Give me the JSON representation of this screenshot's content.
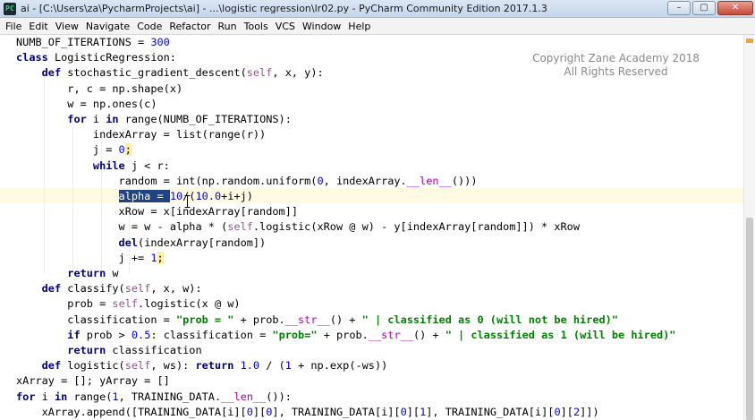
{
  "window": {
    "app_icon_text": "PC",
    "title": "ai - [C:\\Users\\za\\PycharmProjects\\ai] - ...\\logistic regression\\lr02.py - PyCharm Community Edition 2017.1.3",
    "controls": {
      "minimize": "–",
      "maximize": "▢",
      "close": "✕"
    }
  },
  "menu": [
    "File",
    "Edit",
    "View",
    "Navigate",
    "Code",
    "Refactor",
    "Run",
    "Tools",
    "VCS",
    "Window",
    "Help"
  ],
  "watermark": {
    "line1": "Copyright Zane Academy 2018",
    "line2": "All Rights Reserved"
  },
  "code": {
    "l1_a": "NUMB_OF_ITERATIONS = ",
    "l1_b": "300",
    "l2_kw": "class ",
    "l2_rest": "LogisticRegression:",
    "l3_kw": "def ",
    "l3_a": "stochastic_gradient_descent(",
    "l3_self": "self",
    "l3_b": ", x, y):",
    "l4": "r, c = np.shape(x)",
    "l5": "w = np.ones(c)",
    "l6_kw1": "for ",
    "l6_a": "i ",
    "l6_kw2": "in ",
    "l6_b": "range(NUMB_OF_ITERATIONS):",
    "l7": "indexArray = list(range(r))",
    "l8_a": "j = ",
    "l8_num": "0",
    "l8_b": ";",
    "l9_kw": "while ",
    "l9_b": "j < r:",
    "l10_a": "random = int(np.random.uniform(",
    "l10_n": "0",
    "l10_b": ", indexArray.",
    "l10_d": "__len__",
    "l10_c": "()))",
    "l11_sel": "alpha = ",
    "l11_n1": "10",
    "l11_a": "/(",
    "l11_n2": "10.0",
    "l11_b": "+i+j)",
    "l12": "xRow = x[indexArray[random]]",
    "l13_a": "w = w - alpha * (",
    "l13_self": "self",
    "l13_b": ".logistic(xRow @ w) - y[indexArray[random]]) * xRow",
    "l14_kw": "del",
    "l14_b": "(indexArray[random])",
    "l15_a": "j += ",
    "l15_num": "1",
    "l15_b": ";",
    "l16_kw": "return ",
    "l16_b": "w",
    "l17_kw": "def ",
    "l17_a": "classify(",
    "l17_self": "self",
    "l17_b": ", x, w):",
    "l18_a": "prob = ",
    "l18_self": "self",
    "l18_b": ".logistic(x @ w)",
    "l19_a": "classification = ",
    "l19_s1": "\"prob = \"",
    "l19_b": " + prob.",
    "l19_d": "__str__",
    "l19_c": "() + ",
    "l19_s2": "\" | classified as 0 (will not be hired)\"",
    "l20_kw": "if ",
    "l20_a": "prob > ",
    "l20_n": "0.5",
    "l20_b": ": classification = ",
    "l20_s1": "\"prob=\"",
    "l20_c": " + prob.",
    "l20_d": "__str__",
    "l20_e": "() + ",
    "l20_s2": "\" | classified as 1 (will be hired)\"",
    "l21_kw": "return ",
    "l21_b": "classification",
    "l22_kw": "def ",
    "l22_a": "logistic(",
    "l22_self": "self",
    "l22_b": ", ws): ",
    "l22_kw2": "return ",
    "l22_n1": "1.0",
    "l22_c": " / (",
    "l22_n2": "1",
    "l22_d": " + np.exp(-ws))",
    "l23": "xArray = []; yArray = []",
    "l24_kw1": "for ",
    "l24_a": "i ",
    "l24_kw2": "in ",
    "l24_b": "range(",
    "l24_n": "1",
    "l24_c": ", TRAINING_DATA.",
    "l24_d": "__len__",
    "l24_e": "()):",
    "l25_a": "xArray.append([TRAINING_DATA[i][",
    "l25_n1": "0",
    "l25_b": "][",
    "l25_n2": "0",
    "l25_c": "], TRAINING_DATA[i][",
    "l25_n3": "0",
    "l25_d": "][",
    "l25_n4": "1",
    "l25_e": "], TRAINING_DATA[i][",
    "l25_n5": "0",
    "l25_f": "][",
    "l25_n6": "2",
    "l25_g": "]])"
  },
  "colors": {
    "keyword": "#000080",
    "number": "#0000ff",
    "string": "#008000",
    "self": "#94558d",
    "dunder": "#b200b2",
    "selection": "#214283",
    "caret_row": "#fffae3",
    "scroll_marker": "#f0a732"
  }
}
